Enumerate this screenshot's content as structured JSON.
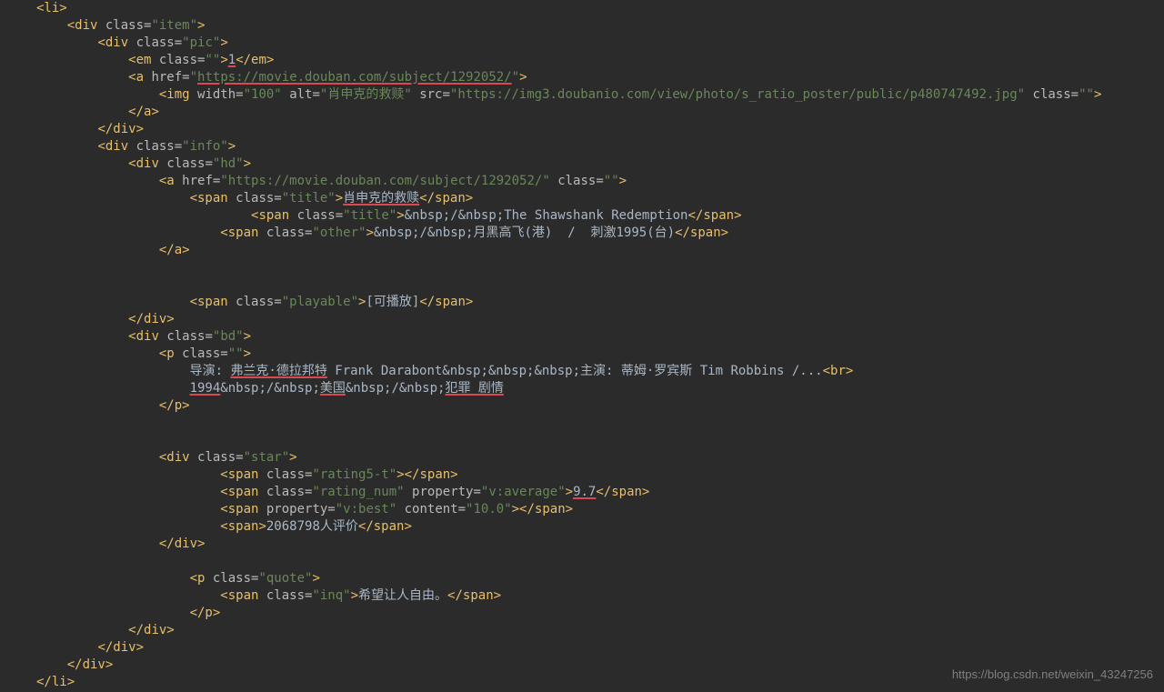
{
  "watermark": "https://blog.csdn.net/weixin_43247256",
  "code": {
    "l1_open": "<li>",
    "l2_div_item": "<div class=\"item\">",
    "l3_div_pic": "<div class=\"pic\">",
    "l4_em_open": "<em class=\"\">",
    "l4_em_txt": "1",
    "l4_em_close": "</em>",
    "l5_a_open": "<a href=\"",
    "l5_a_href": "https://movie.douban.com/subject/1292052/",
    "l5_a_close": "\">",
    "l6_img": "<img width=\"100\" alt=\"肖申克的救赎\" src=\"https://img3.doubanio.com/view/photo/s_ratio_poster/public/p480747492.jpg\" class=\"\">",
    "l7_a_close": "</a>",
    "l8_div_close": "</div>",
    "l9_div_info": "<div class=\"info\">",
    "l10_div_hd": "<div class=\"hd\">",
    "l11_a": "<a href=\"https://movie.douban.com/subject/1292052/\" class=\"\">",
    "l12_span_open": "<span class=\"title\">",
    "l12_span_txt": "肖申克的救赎",
    "l12_span_close": "</span>",
    "l13_span": "<span class=\"title\">&nbsp;/&nbsp;The Shawshank Redemption</span>",
    "l14_span": "<span class=\"other\">&nbsp;/&nbsp;月黑高飞(港)  /  刺激1995(台)</span>",
    "l15_a_close": "</a>",
    "l17_span": "<span class=\"playable\">[可播放]</span>",
    "l18_div_close": "</div>",
    "l19_div_bd": "<div class=\"bd\">",
    "l20_p": "<p class=\"\">",
    "l21_pre": "导演: ",
    "l21_dir": "弗兰克·德拉邦特",
    "l21_rest": " Frank Darabont&nbsp;&nbsp;&nbsp;主演: 蒂姆·罗宾斯 Tim Robbins /...",
    "l21_br": "<br>",
    "l22_year": "1994",
    "l22_sep1": "&nbsp;/&nbsp;",
    "l22_country": "美国",
    "l22_sep2": "&nbsp;/&nbsp;",
    "l22_genre": "犯罪 剧情",
    "l23_p_close": "</p>",
    "l25_div_star": "<div class=\"star\">",
    "l26_span": "<span class=\"rating5-t\"></span>",
    "l27_span_open": "<span class=\"rating_num\" property=\"v:average\">",
    "l27_span_txt": "9.7",
    "l27_span_close": "</span>",
    "l28_span": "<span property=\"v:best\" content=\"10.0\"></span>",
    "l29_span": "<span>2068798人评价</span>",
    "l30_div_close": "</div>",
    "l32_p_quote": "<p class=\"quote\">",
    "l33_span": "<span class=\"inq\">希望让人自由。</span>",
    "l34_p_close": "</p>",
    "l35_div_close": "</div>",
    "l36_div_close": "</div>",
    "l37_div_close": "</div>",
    "l38_li_close": "</li>"
  }
}
